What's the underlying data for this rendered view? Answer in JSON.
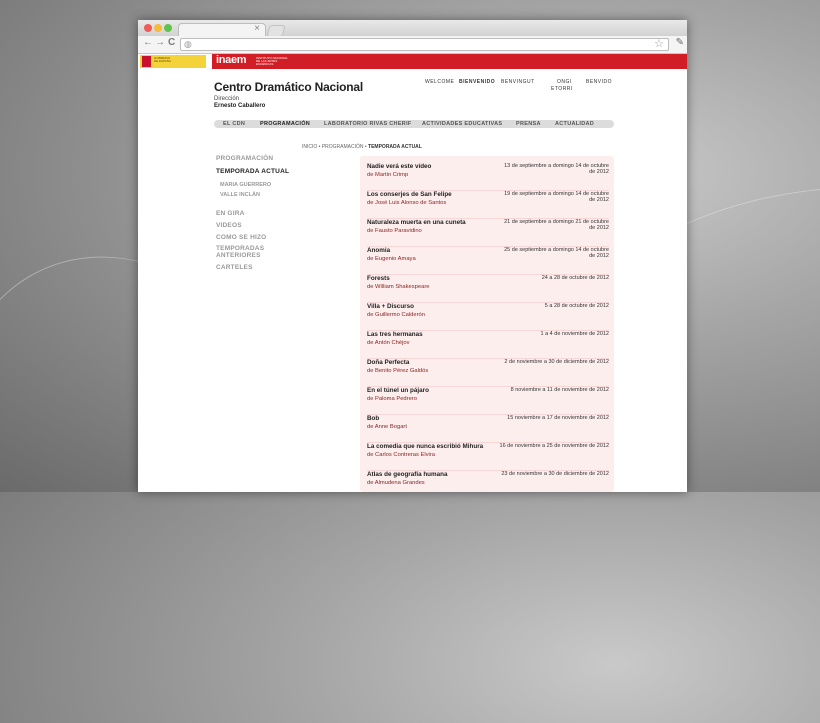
{
  "browser": {
    "tab_close": "×",
    "back": "←",
    "forward": "→",
    "reload": "C",
    "url_icon": "globe-icon",
    "bookmark": "☆",
    "menu": "wrench-icon"
  },
  "site": {
    "title": "Centro Dramático Nacional",
    "direction_label": "Dirección",
    "director": "Ernesto Caballero",
    "logo": "inaem"
  },
  "util_nav": [
    {
      "label": "WELCOME"
    },
    {
      "label": "BIENVENIDO"
    },
    {
      "label": "BENVINGUT"
    },
    {
      "label": "ONGI"
    },
    {
      "label": "ETORRI"
    },
    {
      "label": "BENVIDO"
    }
  ],
  "main_nav": [
    {
      "label": "EL CDN"
    },
    {
      "label": "PROGRAMACIÓN"
    },
    {
      "label": "LABORATORIO RIVAS CHERIF"
    },
    {
      "label": "ACTIVIDADES EDUCATIVAS"
    },
    {
      "label": "PRENSA"
    },
    {
      "label": "ACTUALIDAD"
    }
  ],
  "breadcrumb": {
    "home": "INICIO",
    "sep": "•",
    "section": "PROGRAMACIÓN",
    "current": "TEMPORADA ACTUAL"
  },
  "sidebar": {
    "programacion": "PROGRAMACIÓN",
    "temporada_actual": "TEMPORADA ACTUAL",
    "sub1": "MARIA GUERRERO",
    "sub2": "VALLE INCLÁN",
    "en_gira": "EN GIRA",
    "videos": "VIDEOS",
    "como_se_hizo": "COMO SE HIZO",
    "temporadas_anteriores": "TEMPORADAS ANTERIORES",
    "carteles": "CARTELES"
  },
  "events": [
    {
      "title": "Nadie verá este vídeo",
      "author": "de Martin Crimp",
      "date": "13 de septiembre a domingo 14 de octubre de 2012"
    },
    {
      "title": "Los conserjes de San Felipe",
      "author": "de José Luis Alonso de Santos",
      "date": "19 de septiembre a domingo 14 de octubre de 2012"
    },
    {
      "title": "Naturaleza muerta en una cuneta",
      "author": "de Fausto Paravidino",
      "date": "21 de septiembre a domingo 21 de octubre de 2012"
    },
    {
      "title": "Anomia",
      "author": "de Eugenio Amaya",
      "date": "25 de septiembre a domingo 14 de octubre de 2012"
    },
    {
      "title": "Forests",
      "author": "de William Shakespeare",
      "date": "24 a 28 de octubre de 2012"
    },
    {
      "title": "Villa + Discurso",
      "author": "de Guillermo Calderón",
      "date": "5 a 28 de octubre de 2012"
    },
    {
      "title": "Las tres hermanas",
      "author": "de Antón Chéjov",
      "date": "1 a 4 de noviembre de 2012"
    },
    {
      "title": "Doña Perfecta",
      "author": "de Benito Pérez Galdós",
      "date": "2 de noviembre a 30 de diciembre de 2012"
    },
    {
      "title": "En el túnel un pájaro",
      "author": "de Paloma Pedrero",
      "date": "8 noviembre a 11 de noviembre de 2012"
    },
    {
      "title": "Bob",
      "author": "de Anne Bogart",
      "date": "15 noviembre a 17 de noviembre de 2012"
    },
    {
      "title": "La comedia que nunca escribió Mihura",
      "author": "de Carlos Contreras Elvira",
      "date": "16 de noviembre a 25 de noviembre de 2012"
    },
    {
      "title": "Atlas de geografía humana",
      "author": "de Almudena Grandes",
      "date": "23 de noviembre a 30 de diciembre de 2012"
    }
  ]
}
